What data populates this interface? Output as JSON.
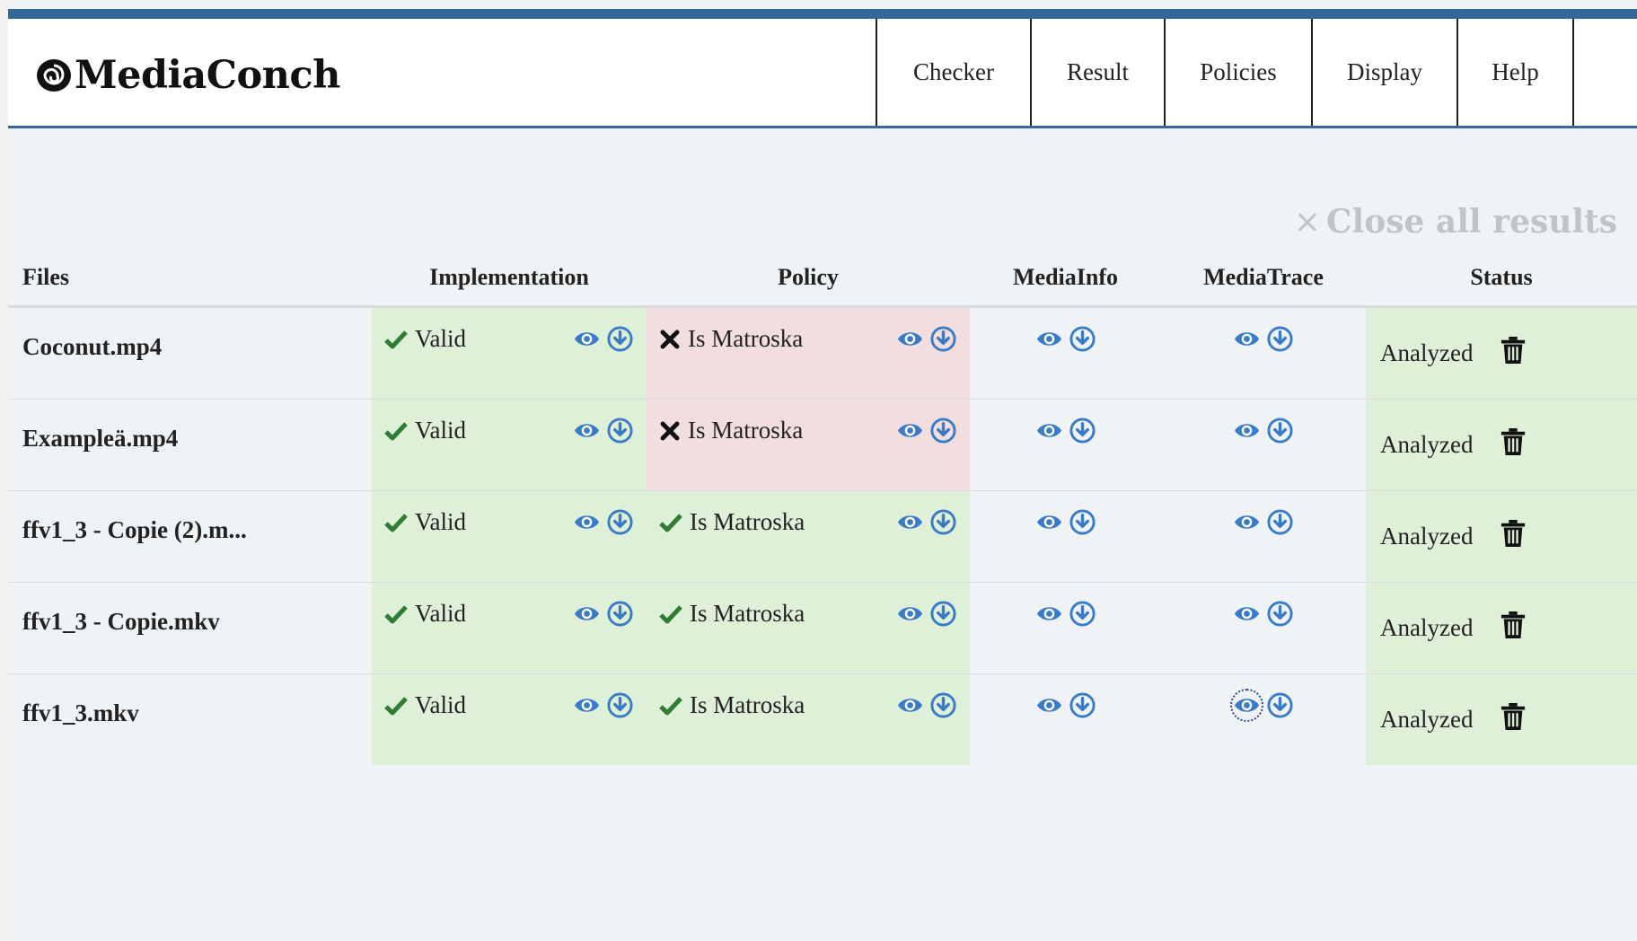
{
  "app": {
    "logo_text": "MediaConch"
  },
  "nav": {
    "items": [
      {
        "label": "Checker"
      },
      {
        "label": "Result"
      },
      {
        "label": "Policies"
      },
      {
        "label": "Display"
      },
      {
        "label": "Help"
      }
    ]
  },
  "actions": {
    "close_all_label": "Close all results",
    "close_all_icon": "×"
  },
  "table": {
    "headers": {
      "files": "Files",
      "implementation": "Implementation",
      "policy": "Policy",
      "mediainfo": "MediaInfo",
      "mediatrace": "MediaTrace",
      "status": "Status"
    },
    "rows": [
      {
        "file": "Coconut.mp4",
        "implementation": "Valid",
        "implementation_ok": true,
        "policy": "Is Matroska",
        "policy_ok": false,
        "status": "Analyzed"
      },
      {
        "file": "Exampleä.mp4",
        "implementation": "Valid",
        "implementation_ok": true,
        "policy": "Is Matroska",
        "policy_ok": false,
        "status": "Analyzed"
      },
      {
        "file": "ffv1_3 - Copie (2).m...",
        "implementation": "Valid",
        "implementation_ok": true,
        "policy": "Is Matroska",
        "policy_ok": true,
        "status": "Analyzed"
      },
      {
        "file": "ffv1_3 - Copie.mkv",
        "implementation": "Valid",
        "implementation_ok": true,
        "policy": "Is Matroska",
        "policy_ok": true,
        "status": "Analyzed"
      },
      {
        "file": "ffv1_3.mkv",
        "implementation": "Valid",
        "implementation_ok": true,
        "policy": "Is Matroska",
        "policy_ok": true,
        "status": "Analyzed"
      }
    ]
  },
  "colors": {
    "accent": "#34679a",
    "icon_blue": "#3a7bc8",
    "valid_bg": "#dff0d8",
    "invalid_bg": "#f2dede",
    "check_green": "#2e7d32"
  },
  "icons": {
    "view": "eye-icon",
    "download": "download-icon",
    "pass": "check-icon",
    "fail": "cross-icon",
    "delete": "trash-icon"
  }
}
